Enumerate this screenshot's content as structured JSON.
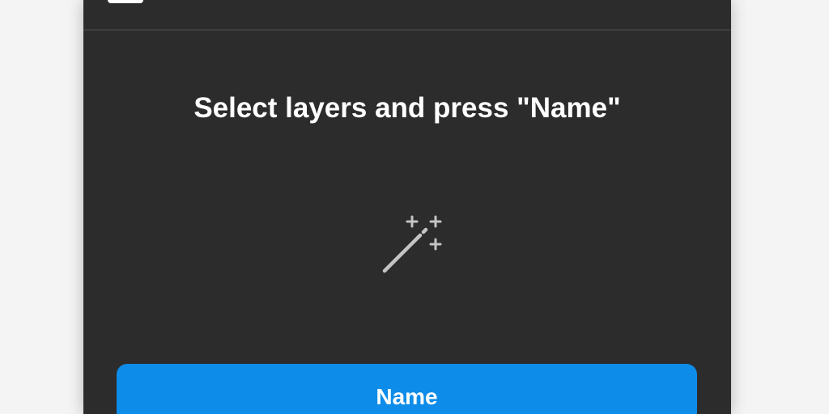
{
  "plugin": {
    "instruction": "Select layers and press \"Name\"",
    "primary_button_label": "Name",
    "hero_icon": "magic-wand-icon"
  },
  "colors": {
    "panel_background": "#2c2c2c",
    "page_background": "#f4f4f4",
    "accent": "#0d8ce9",
    "text": "#ffffff",
    "icon": "#c4c4c4"
  }
}
